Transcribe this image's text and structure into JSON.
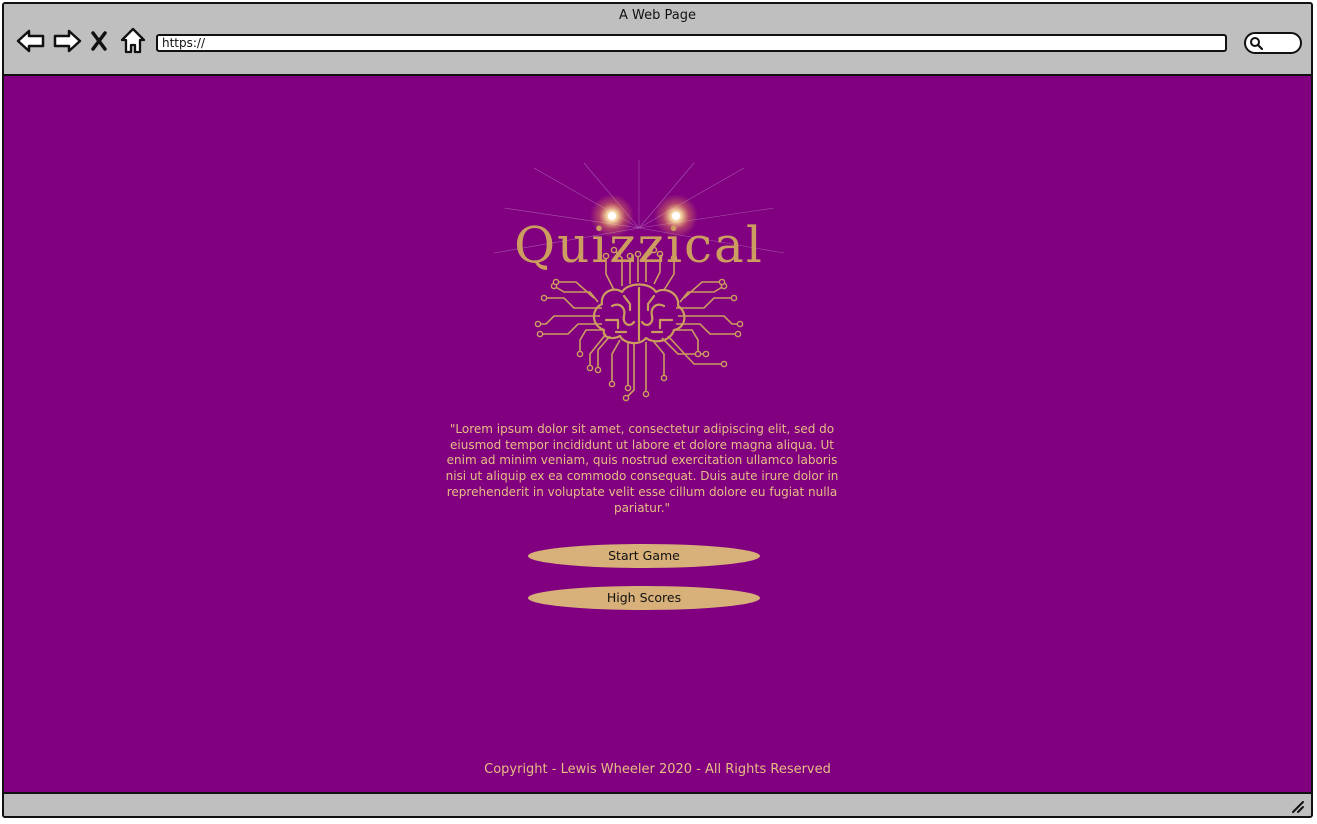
{
  "window": {
    "title": "A Web Page"
  },
  "toolbar": {
    "back_icon": "back-arrow-icon",
    "forward_icon": "forward-arrow-icon",
    "close_icon": "close-icon",
    "home_icon": "home-icon",
    "url": "https://",
    "search_icon": "search-icon"
  },
  "page": {
    "background": "#800080",
    "accent": "#d7b07a",
    "text_color": "#e6bd84",
    "logo": {
      "text": "Quizzical",
      "icon": "circuit-brain-icon"
    },
    "intro": "\"Lorem ipsum dolor sit amet, consectetur adipiscing elit, sed do eiusmod tempor incididunt ut labore et dolore magna aliqua. Ut enim ad minim veniam, quis nostrud exercitation ullamco laboris nisi ut aliquip ex ea commodo consequat. Duis aute irure dolor in reprehenderit in voluptate velit esse cillum dolore eu fugiat nulla pariatur.\"",
    "buttons": {
      "start": "Start Game",
      "high_scores": "High Scores"
    },
    "footer": "Copyright - Lewis Wheeler 2020 - All Rights Reserved"
  }
}
